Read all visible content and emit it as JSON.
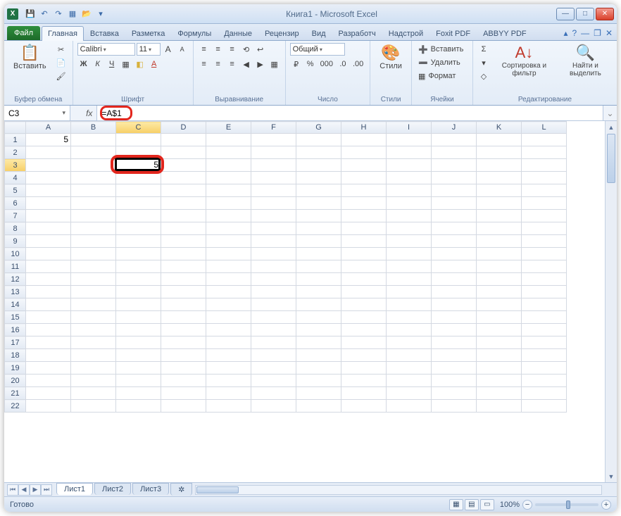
{
  "title": "Книга1  -  Microsoft Excel",
  "qat": {
    "save": "💾",
    "undo": "↶",
    "redo": "↷",
    "new": "▦",
    "open": "📂",
    "more": "▾"
  },
  "tabs": {
    "file": "Файл",
    "items": [
      "Главная",
      "Вставка",
      "Разметка",
      "Формулы",
      "Данные",
      "Рецензир",
      "Вид",
      "Разработч",
      "Надстрой",
      "Foxit PDF",
      "ABBYY PDF"
    ],
    "active": 0
  },
  "winbtns": {
    "min": "—",
    "max": "□",
    "close": "✕"
  },
  "mdi": {
    "min": "—",
    "max": "❐",
    "close": "✕",
    "help": "?",
    "rmin": "▴"
  },
  "ribbon": {
    "clipboard": {
      "label": "Буфер обмена",
      "paste": "Вставить",
      "cut": "✂",
      "copy": "📄",
      "painter": "🖌"
    },
    "font": {
      "label": "Шрифт",
      "name": "Calibri",
      "size": "11",
      "grow": "A",
      "shrink": "A",
      "bold": "Ж",
      "italic": "К",
      "underline": "Ч",
      "border": "▦",
      "fill": "◧",
      "color": "A"
    },
    "align": {
      "label": "Выравнивание",
      "t": "≡",
      "m": "≡",
      "b": "≡",
      "l": "≡",
      "c": "≡",
      "r": "≡",
      "indL": "◀",
      "indR": "▶",
      "wrap": "↩",
      "merge": "▦",
      "orient": "⟲"
    },
    "number": {
      "label": "Число",
      "format": "Общий",
      "cur": "%",
      "pct": "%",
      "comma": "000",
      "inc": ".0",
      "dec": ".00"
    },
    "styles": {
      "label": "Стили",
      "styles": "Стили"
    },
    "cells": {
      "label": "Ячейки",
      "insert": "Вставить",
      "delete": "Удалить",
      "format": "Формат"
    },
    "editing": {
      "label": "Редактирование",
      "sum": "Σ",
      "fill": "▾",
      "clear": "◇",
      "sort": "Сортировка и фильтр",
      "find": "Найти и выделить"
    }
  },
  "namebox": "C3",
  "formula": "=A$1",
  "columns": [
    "A",
    "B",
    "C",
    "D",
    "E",
    "F",
    "G",
    "H",
    "I",
    "J",
    "K",
    "L"
  ],
  "rows": 22,
  "cells": {
    "A1": "5",
    "C3": "5"
  },
  "active": {
    "col": "C",
    "row": 3
  },
  "sheets": {
    "active": "Лист1",
    "others": [
      "Лист2",
      "Лист3"
    ],
    "new": "✲"
  },
  "status": {
    "ready": "Готово",
    "zoom": "100%",
    "views": [
      "▦",
      "▤",
      "▭"
    ]
  }
}
